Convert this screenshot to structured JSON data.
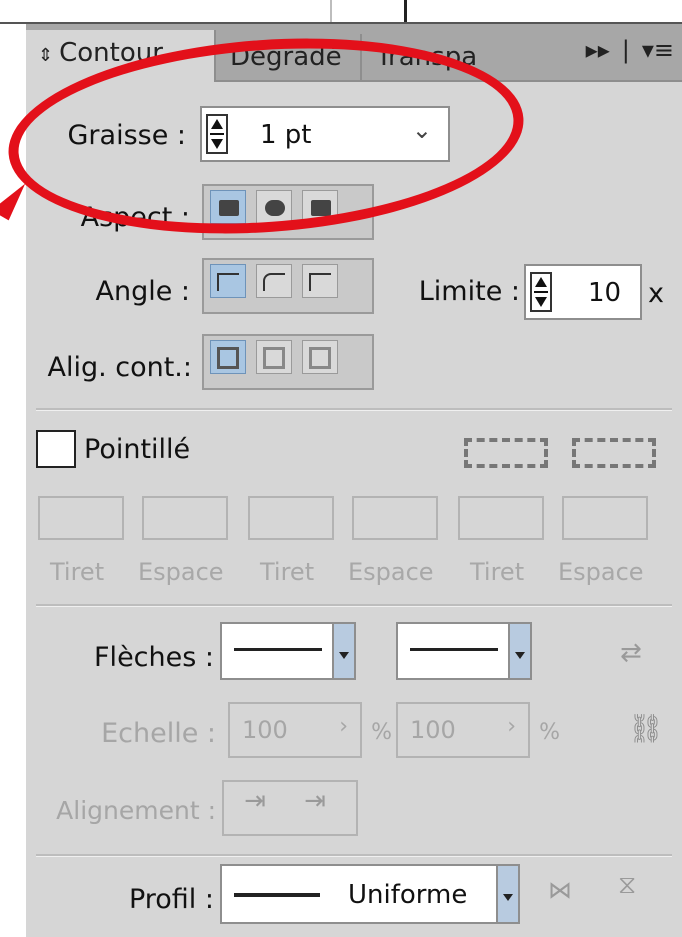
{
  "tabs": {
    "active": "Contour",
    "t2": "Dégradé",
    "t3": "Transpa",
    "icons": [
      "forward-icon",
      "menu-icon"
    ]
  },
  "graisse": {
    "label": "Graisse :",
    "value": "1 pt"
  },
  "aspect": {
    "label": "Aspect :"
  },
  "angle": {
    "label": "Angle :"
  },
  "limite": {
    "label": "Limite :",
    "value": "10",
    "unit": "x"
  },
  "aligcont": {
    "label": "Alig. cont.:"
  },
  "pointille": {
    "label": "Pointillé"
  },
  "dash_labels": [
    "Tiret",
    "Espace",
    "Tiret",
    "Espace",
    "Tiret",
    "Espace"
  ],
  "fleches": {
    "label": "Flèches :"
  },
  "echelle": {
    "label": "Echelle :",
    "value1": "100",
    "value2": "100",
    "unit": "%"
  },
  "alignement": {
    "label": "Alignement :"
  },
  "profil": {
    "label": "Profil :",
    "value": "Uniforme"
  },
  "annotation_color": "#e3101a"
}
